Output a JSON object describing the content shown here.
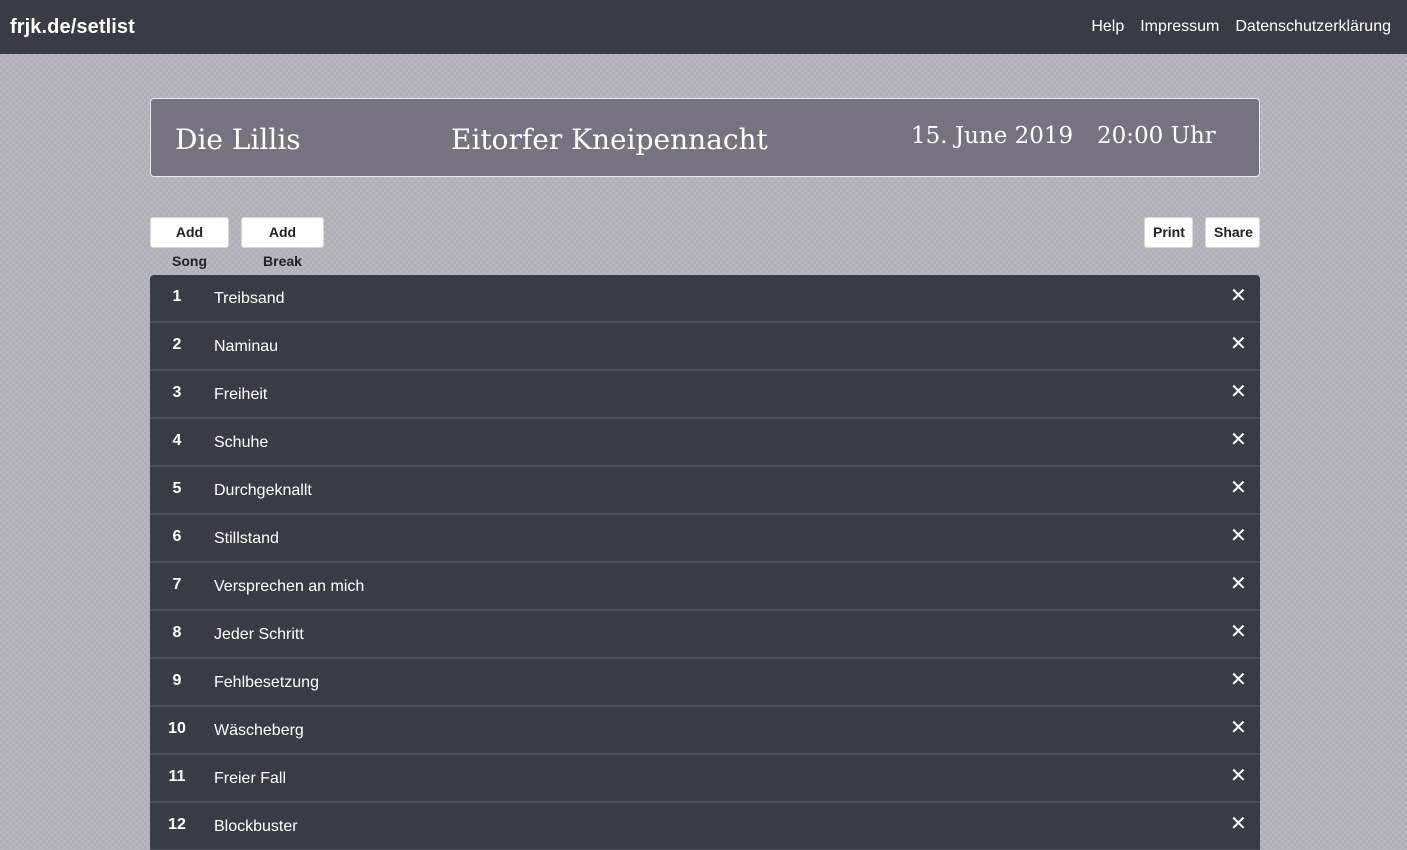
{
  "navbar": {
    "brand": "frjk.de/setlist",
    "links": [
      "Help",
      "Impressum",
      "Datenschutzerklärung"
    ]
  },
  "header": {
    "band": "Die Lillis",
    "event": "Eitorfer Kneipennacht",
    "date": "15. June 2019",
    "time": "20:00 Uhr"
  },
  "toolbar": {
    "add_song": "Add Song",
    "add_break": "Add Break",
    "print": "Print",
    "share": "Share"
  },
  "delete_glyph": "✕",
  "songs": [
    {
      "num": "1",
      "title": "Treibsand"
    },
    {
      "num": "2",
      "title": "Naminau"
    },
    {
      "num": "3",
      "title": "Freiheit"
    },
    {
      "num": "4",
      "title": "Schuhe"
    },
    {
      "num": "5",
      "title": "Durchgeknallt"
    },
    {
      "num": "6",
      "title": "Stillstand"
    },
    {
      "num": "7",
      "title": "Versprechen an mich"
    },
    {
      "num": "8",
      "title": "Jeder Schritt"
    },
    {
      "num": "9",
      "title": "Fehlbesetzung"
    },
    {
      "num": "10",
      "title": "Wäscheberg"
    },
    {
      "num": "11",
      "title": "Freier Fall"
    },
    {
      "num": "12",
      "title": "Blockbuster"
    }
  ]
}
